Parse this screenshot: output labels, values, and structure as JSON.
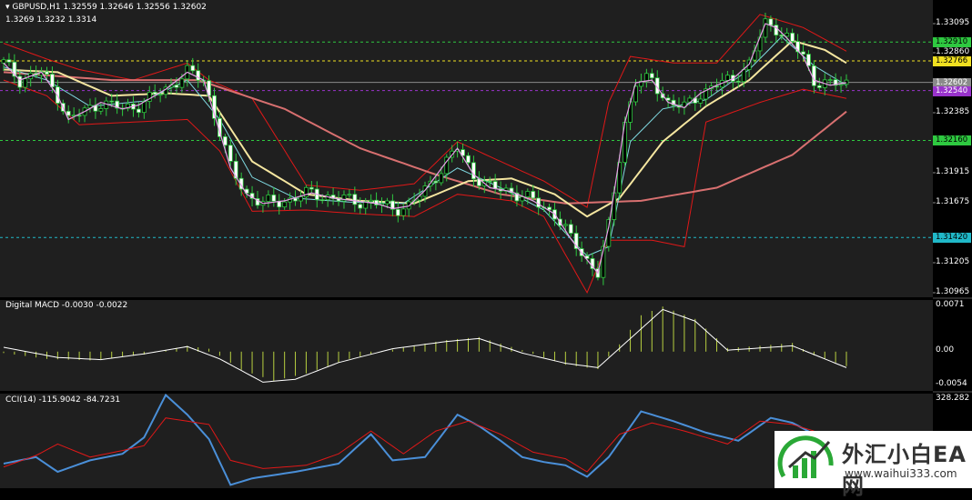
{
  "header": {
    "symbol": "GBPUSD,H1",
    "ohlc": "1.32559 1.32646 1.32556 1.32602",
    "levels": "1.3269 1.3232 1.3314"
  },
  "macd": {
    "title": "Digital MACD -0.0030 -0.0022",
    "ticks": [
      "0.0071",
      "0.00",
      "-0.0054"
    ]
  },
  "cci": {
    "title": "CCI(14) -115.9042 -84.7231",
    "top_tick": "328.282"
  },
  "price_axis": {
    "ticks": [
      "1.33095",
      "1.32860",
      "1.32385",
      "1.31915",
      "1.31675",
      "1.31205",
      "1.30965"
    ]
  },
  "hlines": [
    {
      "price": 1.3291,
      "label": "1.32910",
      "color": "#2ec940",
      "text_color": "#000"
    },
    {
      "price": 1.32766,
      "label": "1.32766",
      "color": "#f0e020",
      "text_color": "#000"
    },
    {
      "price": 1.32602,
      "label": "1.32602",
      "color": "#8a8a8a",
      "text_color": "#fff"
    },
    {
      "price": 1.3254,
      "label": "1.32540",
      "color": "#9933cc",
      "text_color": "#fff"
    },
    {
      "price": 1.3216,
      "label": "1.32160",
      "color": "#2ec940",
      "text_color": "#000"
    },
    {
      "price": 1.3142,
      "label": "1.31420",
      "color": "#20b8c8",
      "text_color": "#000"
    }
  ],
  "watermark": {
    "text_cn": "外汇小白EA网",
    "url": "www.waihui333.com"
  },
  "chart_data": [
    {
      "type": "candlestick",
      "symbol": "GBPUSD",
      "timeframe": "H1",
      "ylim": [
        1.30965,
        1.3323
      ],
      "close_path": [
        [
          0,
          1.3275
        ],
        [
          3,
          1.3262
        ],
        [
          7,
          1.3268
        ],
        [
          10,
          1.325
        ],
        [
          12,
          1.3232
        ],
        [
          15,
          1.3238
        ],
        [
          18,
          1.3245
        ],
        [
          22,
          1.324
        ],
        [
          25,
          1.3243
        ],
        [
          30,
          1.3255
        ],
        [
          34,
          1.3268
        ],
        [
          37,
          1.3262
        ],
        [
          39,
          1.3236
        ],
        [
          42,
          1.3195
        ],
        [
          45,
          1.3175
        ],
        [
          48,
          1.3168
        ],
        [
          52,
          1.317
        ],
        [
          57,
          1.3176
        ],
        [
          61,
          1.3172
        ],
        [
          65,
          1.317
        ],
        [
          69,
          1.3168
        ],
        [
          72,
          1.3164
        ],
        [
          75,
          1.3166
        ],
        [
          78,
          1.3178
        ],
        [
          82,
          1.32
        ],
        [
          84,
          1.321
        ],
        [
          87,
          1.319
        ],
        [
          90,
          1.318
        ],
        [
          94,
          1.3177
        ],
        [
          98,
          1.317
        ],
        [
          102,
          1.316
        ],
        [
          105,
          1.3141
        ],
        [
          108,
          1.3125
        ],
        [
          110,
          1.3115
        ],
        [
          112,
          1.315
        ],
        [
          115,
          1.323
        ],
        [
          117,
          1.326
        ],
        [
          120,
          1.3262
        ],
        [
          123,
          1.3245
        ],
        [
          126,
          1.3241
        ],
        [
          129,
          1.3252
        ],
        [
          132,
          1.3258
        ],
        [
          135,
          1.3263
        ],
        [
          138,
          1.3274
        ],
        [
          141,
          1.3305
        ],
        [
          143,
          1.3302
        ],
        [
          145,
          1.3294
        ],
        [
          148,
          1.328
        ],
        [
          150,
          1.3262
        ],
        [
          153,
          1.3258
        ],
        [
          156,
          1.326
        ]
      ],
      "ma_fast": [
        [
          0,
          1.3272
        ],
        [
          8,
          1.3262
        ],
        [
          16,
          1.3242
        ],
        [
          26,
          1.3246
        ],
        [
          34,
          1.3262
        ],
        [
          40,
          1.3232
        ],
        [
          46,
          1.3188
        ],
        [
          54,
          1.3172
        ],
        [
          64,
          1.3169
        ],
        [
          74,
          1.3168
        ],
        [
          84,
          1.3195
        ],
        [
          92,
          1.318
        ],
        [
          100,
          1.3163
        ],
        [
          108,
          1.3128
        ],
        [
          112,
          1.3135
        ],
        [
          116,
          1.3215
        ],
        [
          122,
          1.324
        ],
        [
          130,
          1.3247
        ],
        [
          138,
          1.327
        ],
        [
          144,
          1.3295
        ],
        [
          150,
          1.3273
        ],
        [
          156,
          1.3258
        ]
      ],
      "ma_slow": [
        [
          0,
          1.327
        ],
        [
          10,
          1.3268
        ],
        [
          20,
          1.325
        ],
        [
          30,
          1.3252
        ],
        [
          38,
          1.325
        ],
        [
          46,
          1.32
        ],
        [
          56,
          1.3175
        ],
        [
          66,
          1.317
        ],
        [
          76,
          1.3168
        ],
        [
          86,
          1.3185
        ],
        [
          94,
          1.3187
        ],
        [
          102,
          1.3175
        ],
        [
          108,
          1.3158
        ],
        [
          114,
          1.3172
        ],
        [
          122,
          1.3215
        ],
        [
          130,
          1.3242
        ],
        [
          138,
          1.3262
        ],
        [
          146,
          1.3292
        ],
        [
          152,
          1.3285
        ],
        [
          156,
          1.3275
        ]
      ],
      "ma_long": [
        [
          0,
          1.3268
        ],
        [
          20,
          1.3262
        ],
        [
          36,
          1.3262
        ],
        [
          52,
          1.324
        ],
        [
          66,
          1.321
        ],
        [
          80,
          1.319
        ],
        [
          92,
          1.3175
        ],
        [
          104,
          1.3168
        ],
        [
          118,
          1.317
        ],
        [
          132,
          1.318
        ],
        [
          146,
          1.3205
        ],
        [
          156,
          1.3238
        ]
      ],
      "band_upper": [
        [
          0,
          1.329
        ],
        [
          8,
          1.3278
        ],
        [
          14,
          1.327
        ],
        [
          24,
          1.3262
        ],
        [
          34,
          1.3275
        ],
        [
          38,
          1.3262
        ],
        [
          46,
          1.3248
        ],
        [
          56,
          1.3182
        ],
        [
          66,
          1.3178
        ],
        [
          76,
          1.3183
        ],
        [
          84,
          1.3215
        ],
        [
          92,
          1.32
        ],
        [
          100,
          1.3185
        ],
        [
          108,
          1.3165
        ],
        [
          112,
          1.3245
        ],
        [
          116,
          1.328
        ],
        [
          124,
          1.3275
        ],
        [
          132,
          1.3275
        ],
        [
          140,
          1.3312
        ],
        [
          148,
          1.3302
        ],
        [
          156,
          1.3284
        ]
      ],
      "band_lower": [
        [
          0,
          1.3262
        ],
        [
          8,
          1.325
        ],
        [
          14,
          1.3228
        ],
        [
          24,
          1.323
        ],
        [
          34,
          1.3232
        ],
        [
          40,
          1.3208
        ],
        [
          46,
          1.3162
        ],
        [
          56,
          1.3163
        ],
        [
          66,
          1.316
        ],
        [
          76,
          1.3158
        ],
        [
          84,
          1.3175
        ],
        [
          94,
          1.317
        ],
        [
          100,
          1.3158
        ],
        [
          108,
          1.31
        ],
        [
          112,
          1.314
        ],
        [
          120,
          1.314
        ],
        [
          126,
          1.3135
        ],
        [
          130,
          1.323
        ],
        [
          140,
          1.3245
        ],
        [
          148,
          1.3255
        ],
        [
          156,
          1.3248
        ]
      ]
    },
    {
      "type": "bar",
      "name": "Digital MACD",
      "ylim": [
        -0.0054,
        0.0071
      ],
      "histogram_path": [
        [
          0,
          -0.0002
        ],
        [
          8,
          -0.001
        ],
        [
          16,
          -0.0012
        ],
        [
          26,
          -0.0004
        ],
        [
          34,
          0.0008
        ],
        [
          38,
          0.0004
        ],
        [
          44,
          -0.0025
        ],
        [
          50,
          -0.004
        ],
        [
          56,
          -0.003
        ],
        [
          64,
          -0.001
        ],
        [
          74,
          0.0006
        ],
        [
          82,
          0.0016
        ],
        [
          88,
          0.002
        ],
        [
          96,
          0.0002
        ],
        [
          104,
          -0.0018
        ],
        [
          110,
          -0.0024
        ],
        [
          114,
          0.001
        ],
        [
          118,
          0.005
        ],
        [
          122,
          0.0062
        ],
        [
          128,
          0.0045
        ],
        [
          134,
          0.0005
        ],
        [
          140,
          0.0008
        ],
        [
          146,
          0.0012
        ],
        [
          150,
          -0.0005
        ],
        [
          156,
          -0.002
        ]
      ],
      "signal_path": [
        [
          0,
          0.0006
        ],
        [
          10,
          -0.0008
        ],
        [
          18,
          -0.0011
        ],
        [
          26,
          -0.0003
        ],
        [
          34,
          0.0007
        ],
        [
          40,
          -0.001
        ],
        [
          48,
          -0.0042
        ],
        [
          54,
          -0.0038
        ],
        [
          62,
          -0.0015
        ],
        [
          72,
          0.0004
        ],
        [
          82,
          0.0014
        ],
        [
          88,
          0.0018
        ],
        [
          96,
          -0.0002
        ],
        [
          104,
          -0.0016
        ],
        [
          110,
          -0.0022
        ],
        [
          116,
          0.0018
        ],
        [
          122,
          0.0058
        ],
        [
          128,
          0.0042
        ],
        [
          134,
          0.0002
        ],
        [
          140,
          0.0005
        ],
        [
          146,
          0.0008
        ],
        [
          150,
          -0.0004
        ],
        [
          156,
          -0.0022
        ]
      ]
    },
    {
      "type": "line",
      "name": "CCI(14)",
      "top_tick": 328.282,
      "ylim": [
        -250,
        328.282
      ],
      "series": [
        {
          "values_path": [
            [
              0,
              -100
            ],
            [
              6,
              -60
            ],
            [
              10,
              -150
            ],
            [
              16,
              -80
            ],
            [
              22,
              -40
            ],
            [
              26,
              60
            ],
            [
              30,
              320
            ],
            [
              34,
              200
            ],
            [
              38,
              50
            ],
            [
              42,
              -230
            ],
            [
              46,
              -190
            ],
            [
              54,
              -150
            ],
            [
              62,
              -100
            ],
            [
              68,
              80
            ],
            [
              72,
              -80
            ],
            [
              78,
              -60
            ],
            [
              84,
              200
            ],
            [
              88,
              130
            ],
            [
              92,
              40
            ],
            [
              96,
              -60
            ],
            [
              100,
              -90
            ],
            [
              104,
              -110
            ],
            [
              108,
              -180
            ],
            [
              112,
              -60
            ],
            [
              118,
              220
            ],
            [
              124,
              160
            ],
            [
              130,
              90
            ],
            [
              136,
              40
            ],
            [
              142,
              180
            ],
            [
              146,
              150
            ],
            [
              150,
              80
            ]
          ]
        },
        {
          "values_path": [
            [
              0,
              -120
            ],
            [
              6,
              -50
            ],
            [
              10,
              20
            ],
            [
              16,
              -60
            ],
            [
              22,
              -20
            ],
            [
              26,
              10
            ],
            [
              30,
              180
            ],
            [
              34,
              160
            ],
            [
              38,
              140
            ],
            [
              42,
              -80
            ],
            [
              48,
              -130
            ],
            [
              56,
              -110
            ],
            [
              62,
              -40
            ],
            [
              68,
              100
            ],
            [
              74,
              -40
            ],
            [
              80,
              100
            ],
            [
              86,
              160
            ],
            [
              92,
              80
            ],
            [
              98,
              -30
            ],
            [
              104,
              -70
            ],
            [
              108,
              -150
            ],
            [
              114,
              80
            ],
            [
              120,
              150
            ],
            [
              126,
              100
            ],
            [
              134,
              20
            ],
            [
              140,
              160
            ],
            [
              146,
              140
            ],
            [
              150,
              100
            ]
          ]
        }
      ]
    }
  ]
}
